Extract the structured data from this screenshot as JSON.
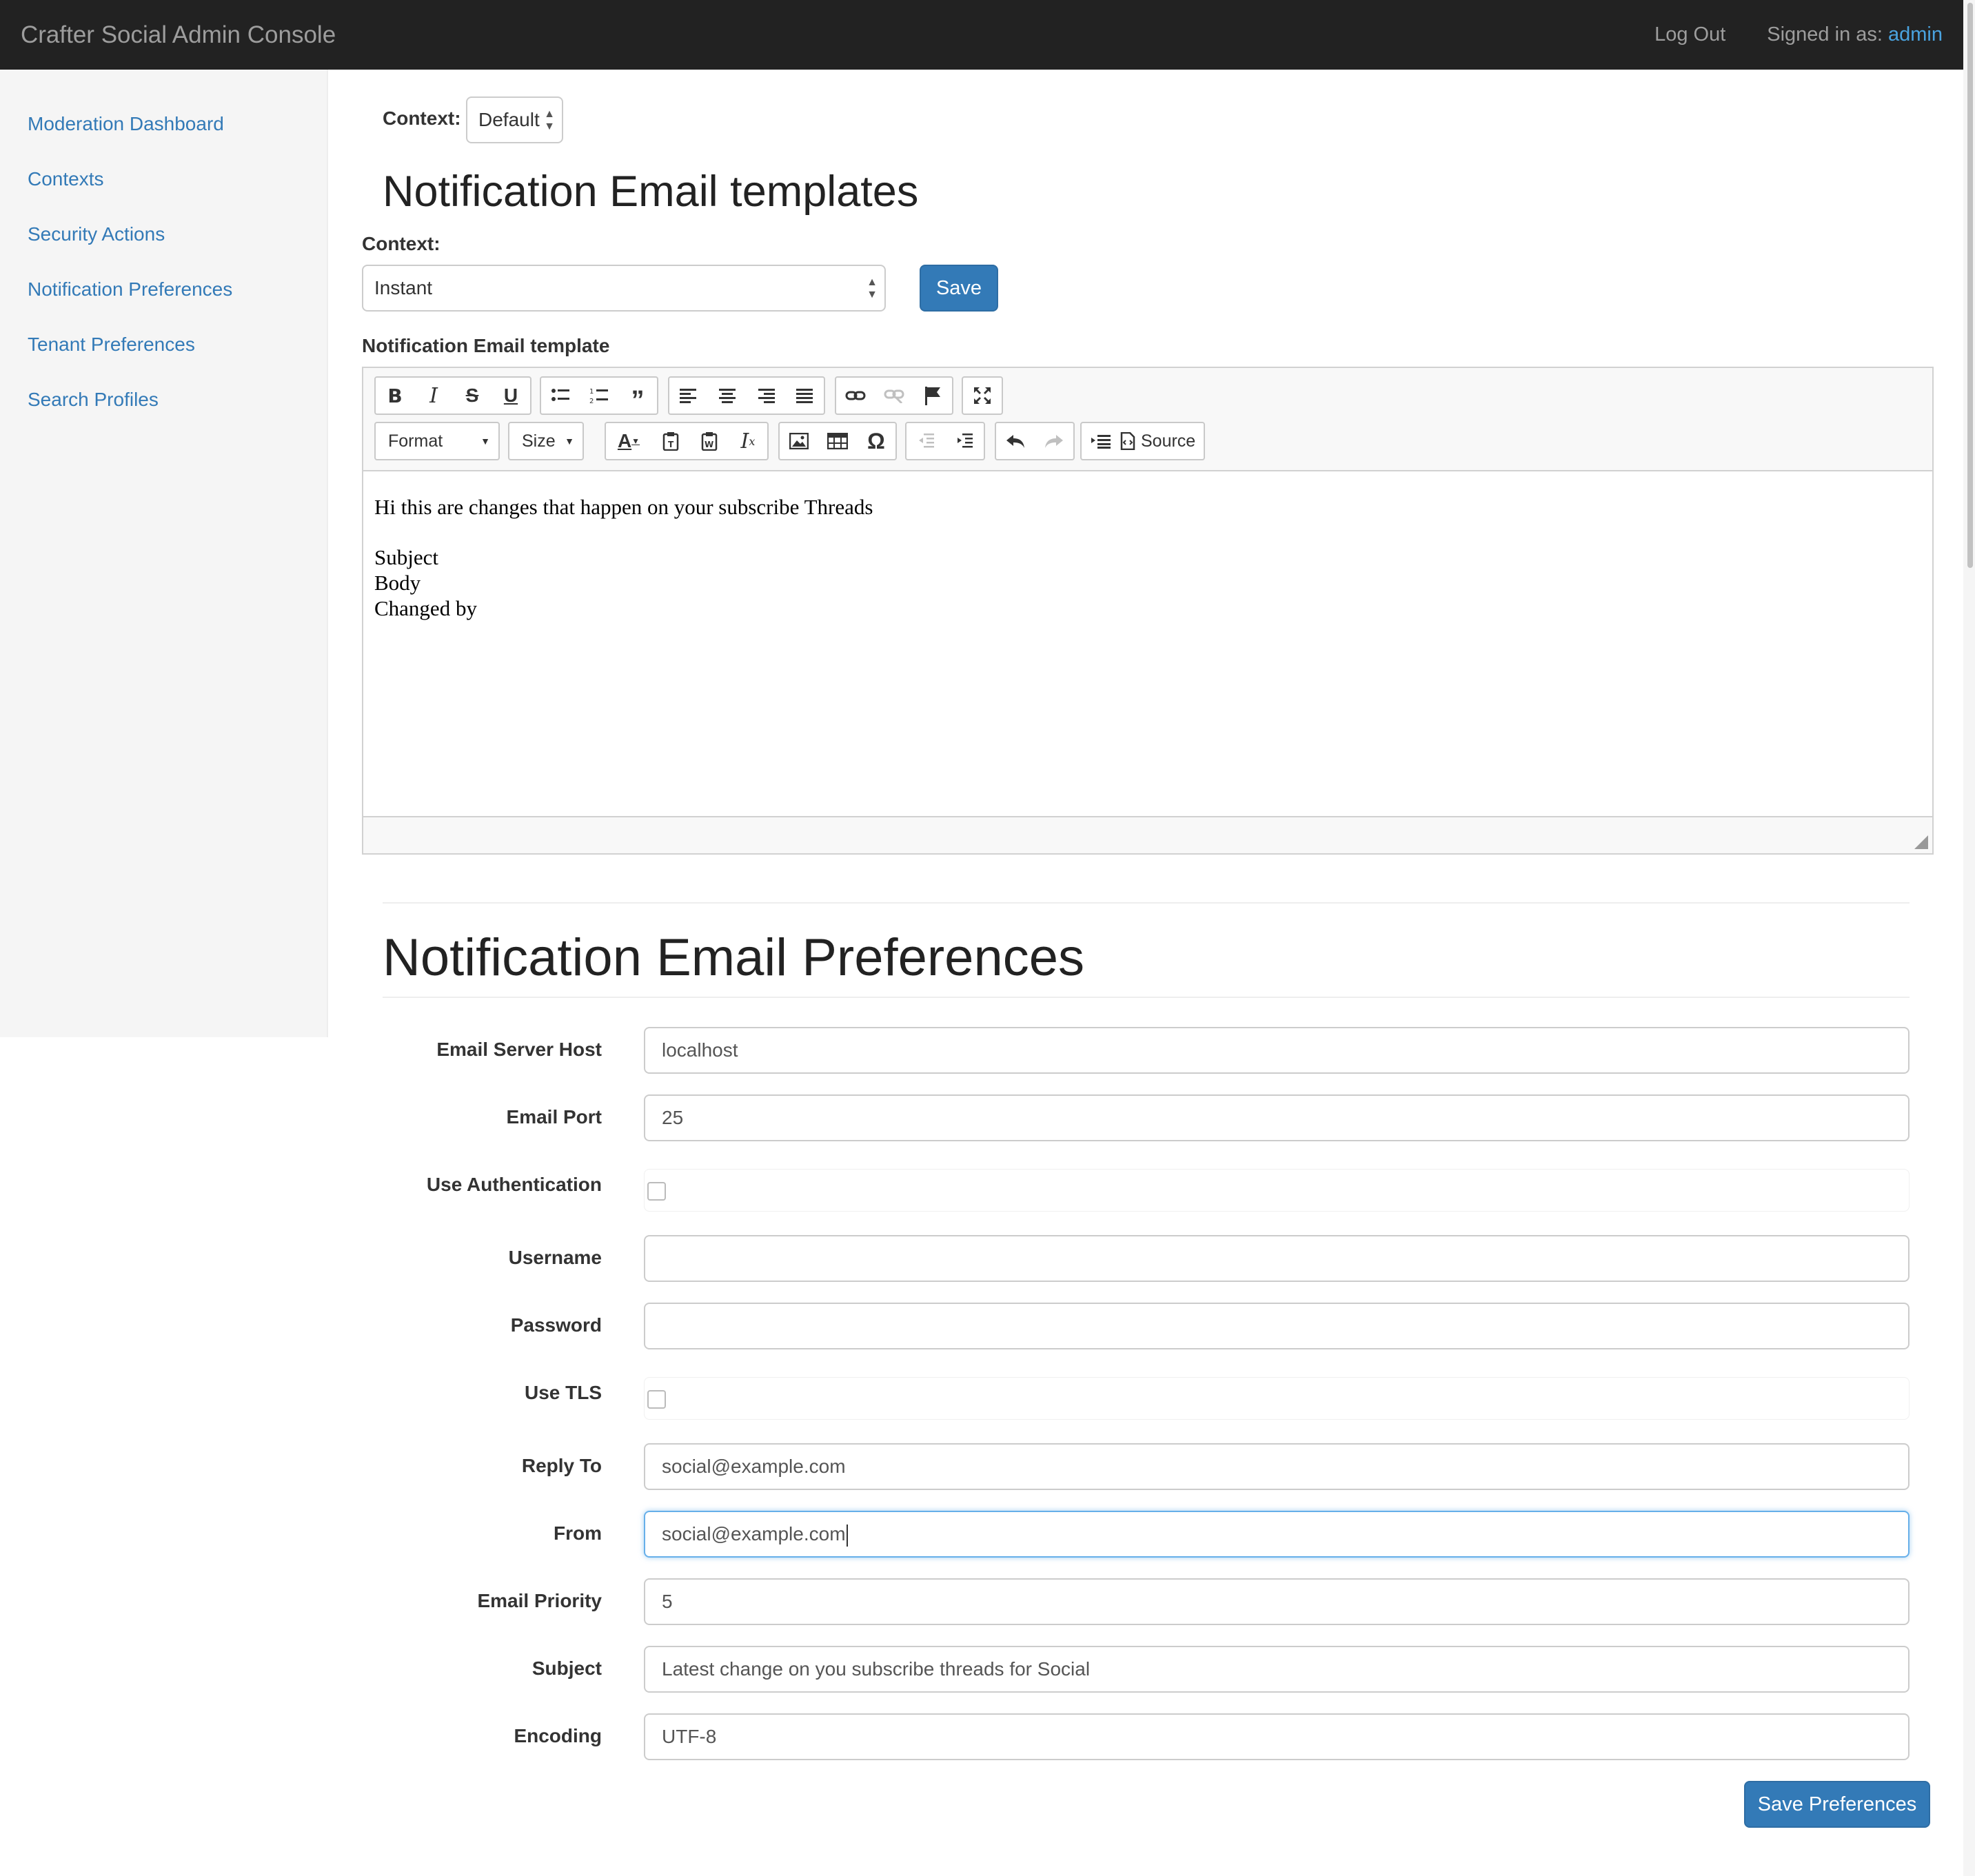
{
  "header": {
    "brand": "Crafter Social Admin Console",
    "logout": "Log Out",
    "signed_in_prefix": "Signed in as:",
    "user": "admin"
  },
  "sidebar": {
    "items": [
      {
        "label": "Moderation Dashboard"
      },
      {
        "label": "Contexts"
      },
      {
        "label": "Security Actions"
      },
      {
        "label": "Notification Preferences"
      },
      {
        "label": "Tenant Preferences"
      },
      {
        "label": "Search Profiles"
      }
    ]
  },
  "context_bar": {
    "label": "Context:",
    "selected": "Default"
  },
  "templates": {
    "heading": "Notification Email templates",
    "context_label": "Context:",
    "context_selected": "Instant",
    "save_label": "Save",
    "editor_label": "Notification Email template",
    "toolbar": {
      "format": "Format",
      "size": "Size",
      "source": "Source"
    },
    "content": {
      "intro": "Hi this are changes that happen on your subscribe Threads",
      "lines": [
        "Subject",
        "Body",
        "Changed by"
      ]
    }
  },
  "preferences": {
    "heading": "Notification Email Preferences",
    "fields": {
      "host": {
        "label": "Email Server Host",
        "value": "localhost"
      },
      "port": {
        "label": "Email Port",
        "value": "25"
      },
      "auth": {
        "label": "Use Authentication",
        "checked": false
      },
      "username": {
        "label": "Username",
        "value": ""
      },
      "password": {
        "label": "Password",
        "value": ""
      },
      "tls": {
        "label": "Use TLS",
        "checked": false
      },
      "reply_to": {
        "label": "Reply To",
        "value": "social@example.com"
      },
      "from": {
        "label": "From",
        "value": "social@example.com"
      },
      "priority": {
        "label": "Email Priority",
        "value": "5"
      },
      "subject": {
        "label": "Subject",
        "value": "Latest change on you subscribe threads for Social"
      },
      "encoding": {
        "label": "Encoding",
        "value": "UTF-8"
      }
    },
    "save_label": "Save Preferences"
  },
  "colors": {
    "navbar": "#222222",
    "link": "#337ab7",
    "primary": "#337ab7"
  }
}
